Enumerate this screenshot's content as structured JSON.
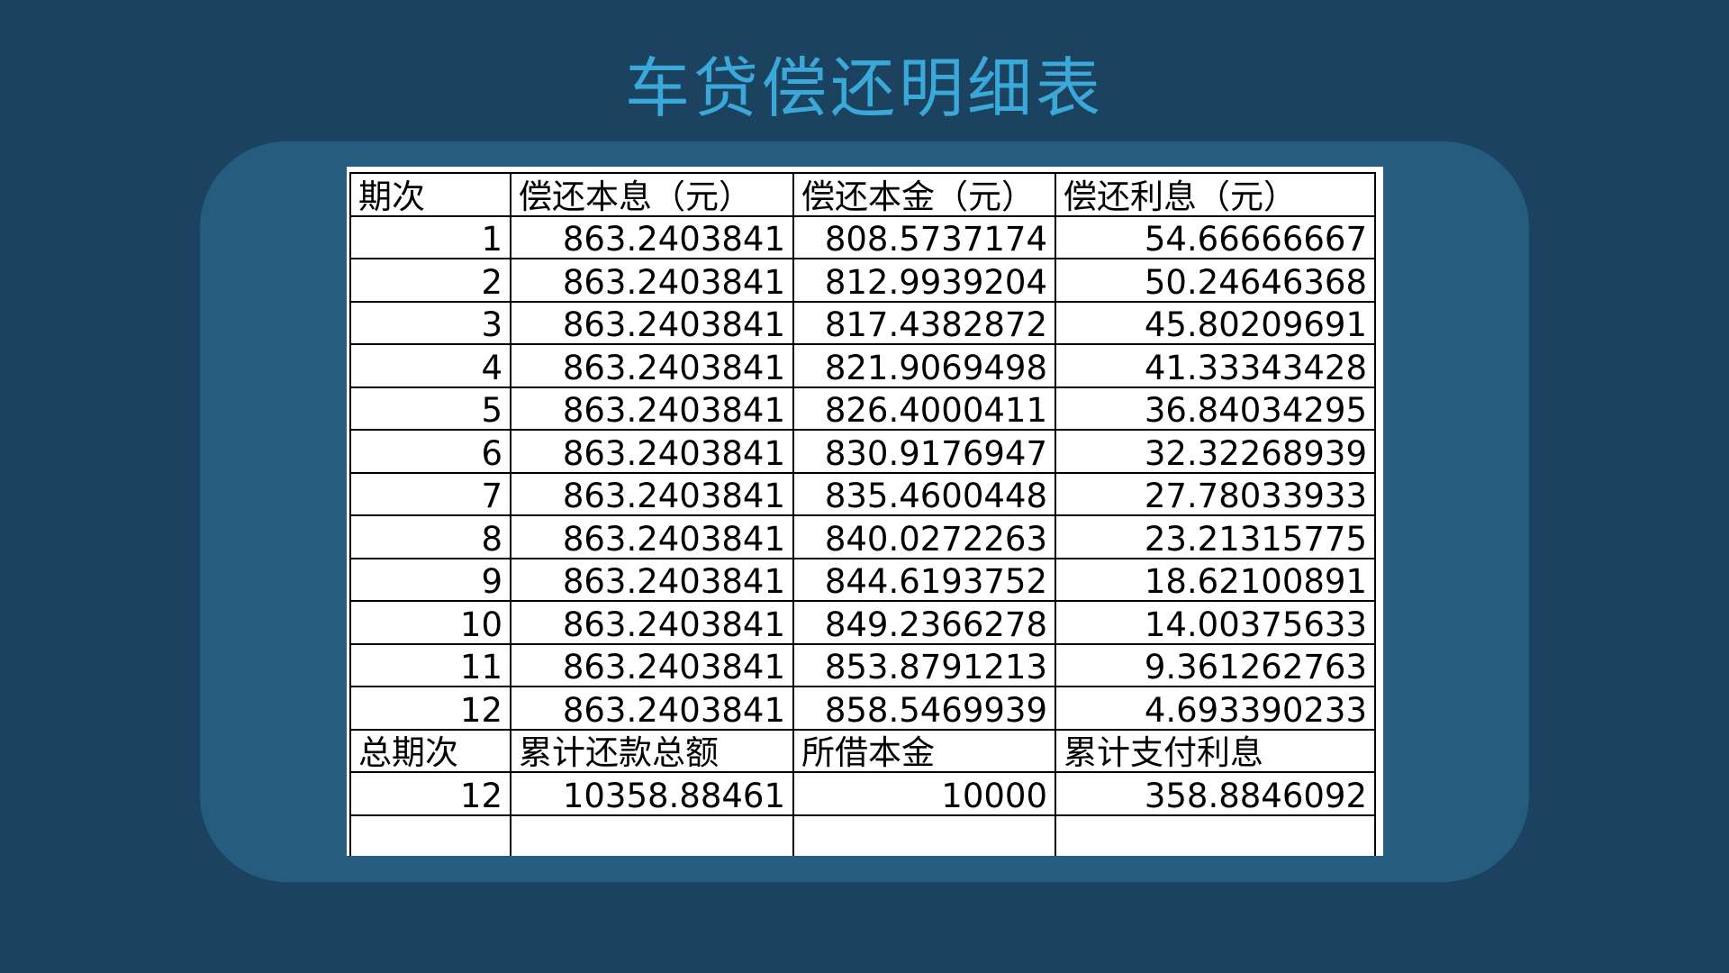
{
  "title": "车贷偿还明细表",
  "table": {
    "headers": [
      "期次",
      "偿还本息（元）",
      "偿还本金（元）",
      "偿还利息（元）"
    ],
    "rows": [
      [
        "1",
        "863.2403841",
        "808.5737174",
        "54.66666667"
      ],
      [
        "2",
        "863.2403841",
        "812.9939204",
        "50.24646368"
      ],
      [
        "3",
        "863.2403841",
        "817.4382872",
        "45.80209691"
      ],
      [
        "4",
        "863.2403841",
        "821.9069498",
        "41.33343428"
      ],
      [
        "5",
        "863.2403841",
        "826.4000411",
        "36.84034295"
      ],
      [
        "6",
        "863.2403841",
        "830.9176947",
        "32.32268939"
      ],
      [
        "7",
        "863.2403841",
        "835.4600448",
        "27.78033933"
      ],
      [
        "8",
        "863.2403841",
        "840.0272263",
        "23.21315775"
      ],
      [
        "9",
        "863.2403841",
        "844.6193752",
        "18.62100891"
      ],
      [
        "10",
        "863.2403841",
        "849.2366278",
        "14.00375633"
      ],
      [
        "11",
        "863.2403841",
        "853.8791213",
        "9.361262763"
      ],
      [
        "12",
        "863.2403841",
        "858.5469939",
        "4.693390233"
      ]
    ],
    "summary_headers": [
      "总期次",
      "累计还款总额",
      "所借本金",
      "累计支付利息"
    ],
    "summary_values": [
      "12",
      "10358.88461",
      "10000",
      "358.8846092"
    ]
  },
  "colors": {
    "background": "#1b425f",
    "panel": "#265d7f",
    "title": "#3aa8d8",
    "sheet": "#ffffff"
  }
}
